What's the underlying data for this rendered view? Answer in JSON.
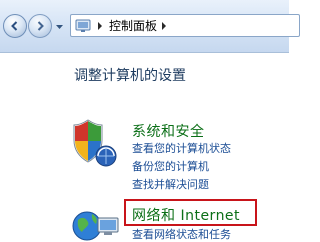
{
  "address_bar": {
    "location": "控制面板"
  },
  "page": {
    "title": "调整计算机的设置"
  },
  "categories": [
    {
      "title": "系统和安全",
      "links": [
        "查看您的计算机状态",
        "备份您的计算机",
        "查找并解决问题"
      ]
    },
    {
      "title": "网络和 Internet",
      "links": [
        "查看网络状态和任务"
      ]
    }
  ],
  "colors": {
    "category_title": "#0b6f17",
    "link": "#1a4c94",
    "highlight": "#c8141a"
  }
}
